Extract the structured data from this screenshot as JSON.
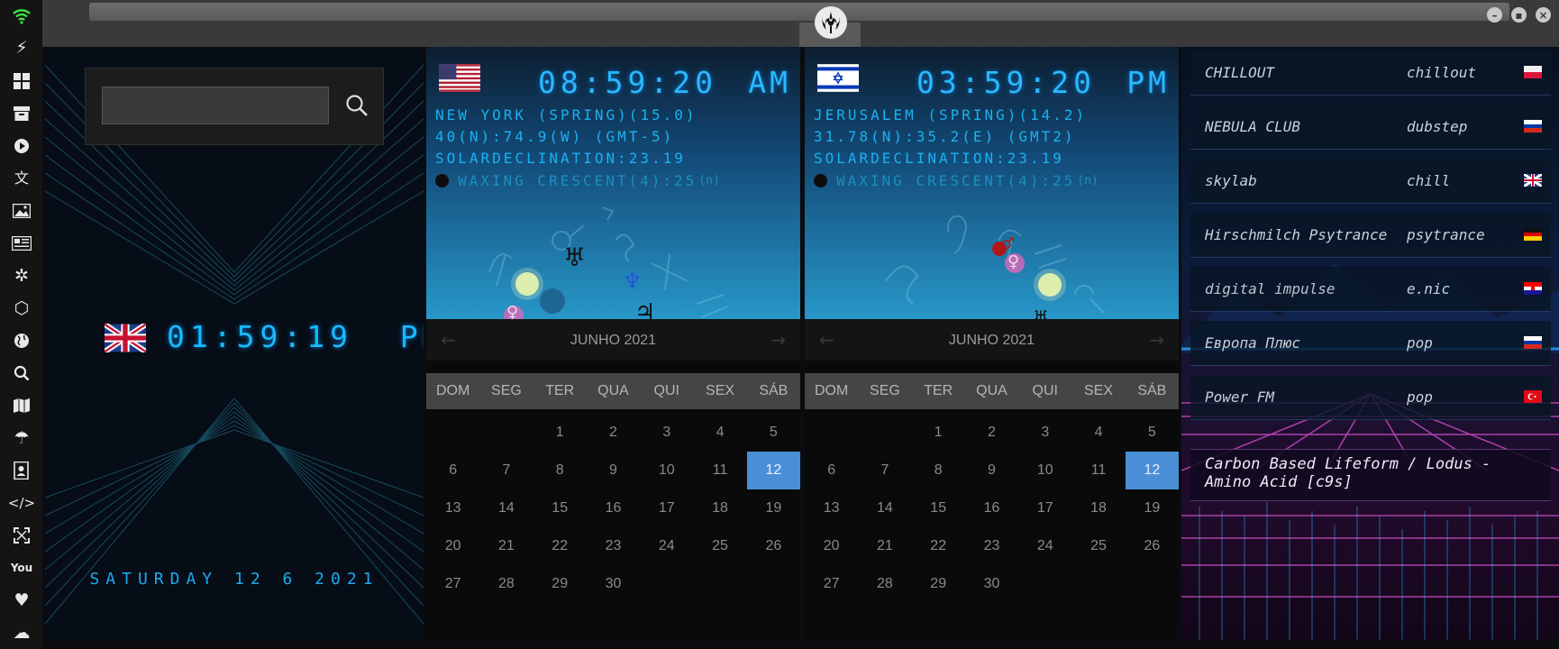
{
  "window": {
    "logo": "rebel-alliance-emblem"
  },
  "window_buttons": [
    "minimize",
    "maximize",
    "close"
  ],
  "sidebar": {
    "icons": [
      "wifi-icon",
      "lightning-icon",
      "windows-icon",
      "archive-icon",
      "play-icon",
      "translate-icon",
      "image-icon",
      "news-icon",
      "settings-icon",
      "hexagon-icon",
      "globe-icon",
      "search-icon",
      "map-icon",
      "umbrella-icon",
      "contacts-icon",
      "code-icon",
      "fullscreen-icon",
      "youtube-icon",
      "heart-icon",
      "cloud-icon"
    ]
  },
  "search": {
    "value": "",
    "placeholder": ""
  },
  "local_clock": {
    "time": "01:59:19",
    "ampm": "PM",
    "date": "SATURDAY 12 6 2021"
  },
  "clocks": [
    {
      "time": "08:59:20",
      "ampm": "AM",
      "line1": "NEW YORK (SPRING)(15.0)",
      "line2": "40(N):74.9(W) (GMT-5)",
      "line3": "SOLARDECLINATION:23.19",
      "moon": "WAXING CRESCENT(4):25",
      "moon_suffix": "(n)"
    },
    {
      "time": "03:59:20",
      "ampm": "PM",
      "line1": "JERUSALEM (SPRING)(14.2)",
      "line2": "31.78(N):35.2(E) (GMT2)",
      "line3": "SOLARDECLINATION:23.19",
      "moon": "WAXING CRESCENT(4):25",
      "moon_suffix": "(n)"
    }
  ],
  "calendar": {
    "month": "JUNHO 2021",
    "prev": "←",
    "next": "→",
    "weekdays": [
      "DOM",
      "SEG",
      "TER",
      "QUA",
      "QUI",
      "SEX",
      "SÁB"
    ],
    "days": [
      "",
      "",
      "1",
      "2",
      "3",
      "4",
      "5",
      "6",
      "7",
      "8",
      "9",
      "10",
      "11",
      "12",
      "13",
      "14",
      "15",
      "16",
      "17",
      "18",
      "19",
      "20",
      "21",
      "22",
      "23",
      "24",
      "25",
      "26",
      "27",
      "28",
      "29",
      "30"
    ],
    "today": "12"
  },
  "radio": {
    "stations": [
      {
        "name": "CHILLOUT",
        "genre": "chillout",
        "flag": "poland"
      },
      {
        "name": "NEBULA CLUB",
        "genre": "dubstep",
        "flag": "russia"
      },
      {
        "name": "skylab",
        "genre": "chill",
        "flag": "uk"
      },
      {
        "name": "Hirschmilch Psytrance",
        "genre": "psytrance",
        "flag": "germany"
      },
      {
        "name": "digital impulse",
        "genre": "e.nic",
        "flag": "croatia"
      },
      {
        "name": "Европа Плюс",
        "genre": "pop",
        "flag": "russia"
      },
      {
        "name": "Power FM",
        "genre": "pop",
        "flag": "turkey"
      }
    ],
    "now_playing": "Carbon Based Lifeform / Lodus - Amino Acid [c9s]"
  },
  "colors": {
    "clock_cyan": "#2ab8ff",
    "today_highlight": "#4a8fd6",
    "wifi_green": "#3fe042"
  }
}
